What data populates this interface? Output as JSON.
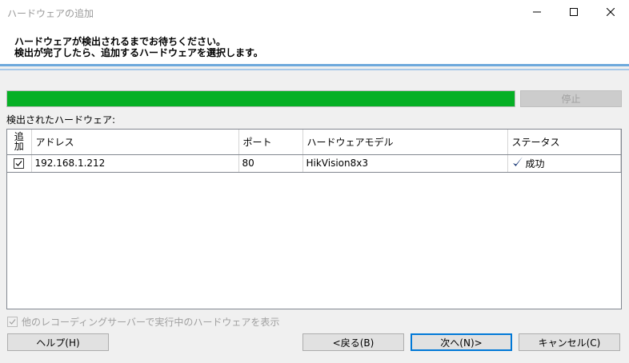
{
  "window": {
    "title": "ハードウェアの追加",
    "minimize_icon": "minimize-icon",
    "maximize_icon": "maximize-icon",
    "close_icon": "close-icon"
  },
  "header": {
    "line1": "ハードウェアが検出されるまでお待ちください。",
    "line2": "検出が完了したら、追加するハードウェアを選択します。"
  },
  "progress": {
    "value": 1.0,
    "color": "#06b025"
  },
  "stop_button": {
    "label": "停止",
    "enabled": false
  },
  "found_label": "検出されたハードウェア:",
  "table": {
    "headers": {
      "add": "追\n加",
      "address": "アドレス",
      "port": "ポート",
      "model": "ハードウェアモデル",
      "status": "ステータス"
    },
    "rows": [
      {
        "checked": true,
        "address": "192.168.1.212",
        "port": "80",
        "model": "HikVision8x3",
        "status": "成功",
        "status_icon": "checkmark-icon"
      }
    ]
  },
  "show_other_servers": {
    "label": "他のレコーディングサーバーで実行中のハードウェアを表示",
    "checked": true,
    "enabled": false
  },
  "buttons": {
    "help": "ヘルプ(H)",
    "back": "<戻る(B)",
    "next": "次へ(N)>",
    "cancel": "キャンセル(C)"
  },
  "colors": {
    "accent": "#0078d7",
    "success": "#06b025",
    "check": "#1f3d7a"
  }
}
